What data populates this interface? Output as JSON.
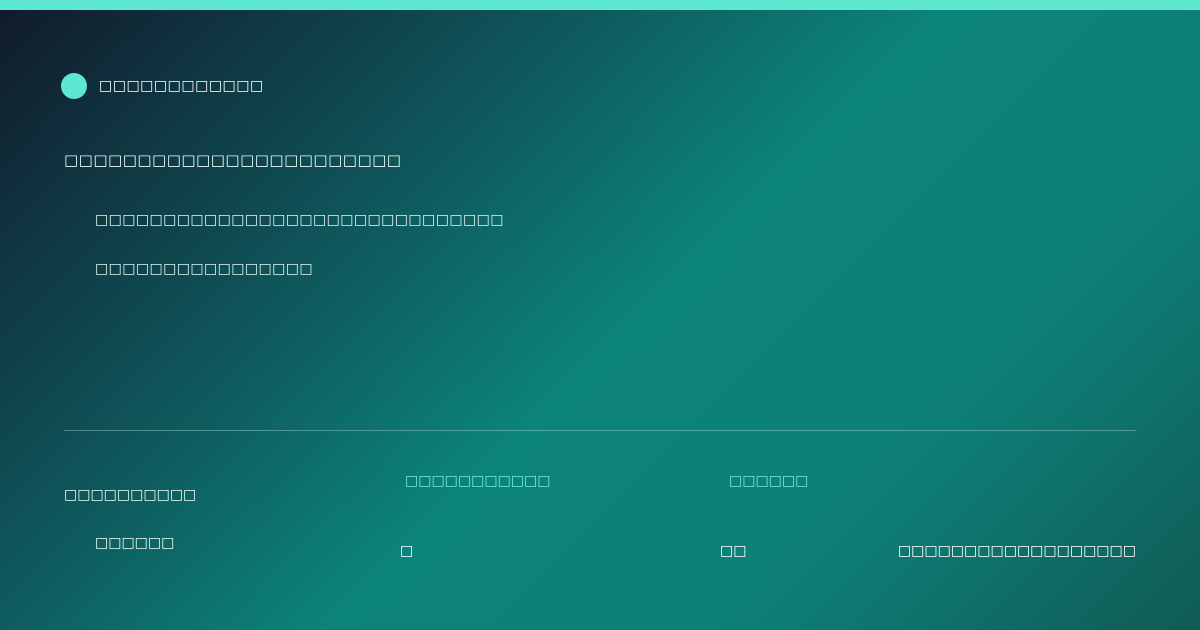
{
  "brand": {
    "name": "□□□□□□□□□□□□",
    "dot_color": "#5ee8d2"
  },
  "headline": "□□□□□□□□□□□□□□□□□□□□□□□",
  "body": {
    "line1": "□□□□□□□□□□□□□□□□□□□□□□□□□□□□□□",
    "line2": "□□□□□□□□□□□□□□□□"
  },
  "footer": {
    "left_label": "□□□□□□□□□□",
    "left_sub": "□□□□□□",
    "col2_label": "□□□□□□□□□□□",
    "col2_value": "□",
    "col3_label": "□□□□□□",
    "col3_value": "□□",
    "right_value": "□□□□□□□□□□□□□□□□□□"
  },
  "colors": {
    "accent": "#5ee8d2",
    "accent_text": "#6ef0d8"
  }
}
